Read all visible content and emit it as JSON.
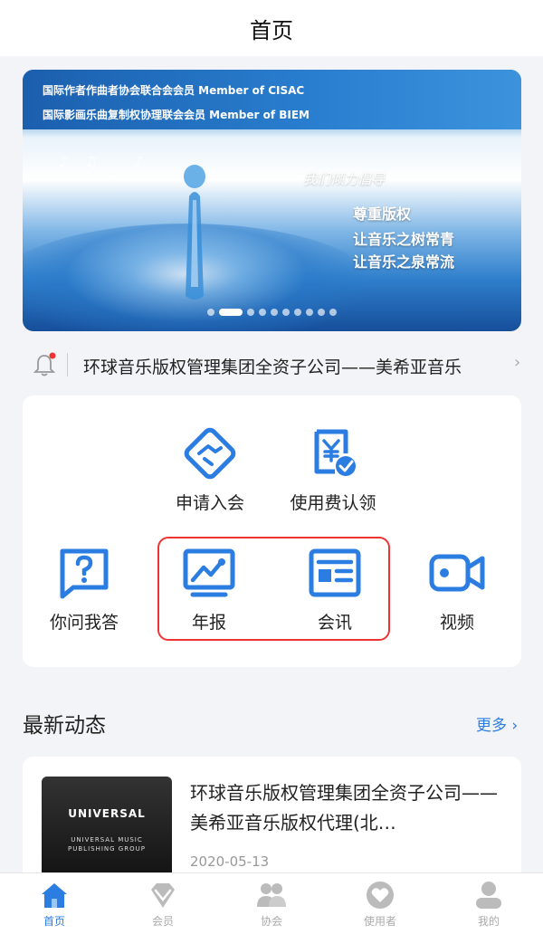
{
  "header": {
    "title": "首页"
  },
  "banner": {
    "line1": "国际作者作曲者协会联合会会员 Member of CISAC",
    "line2": "国际影画乐曲复制权协理联会会员 Member of BIEM",
    "slogan": "我们倾力倡导",
    "slogan_line1": "尊重版权",
    "slogan_line2": "让音乐之树常青",
    "slogan_line3": "让音乐之泉常流",
    "slide_count": 10,
    "active_slide": 1
  },
  "notice": {
    "icon": "bell-icon",
    "text": "环球音乐版权管理集团全资子公司——美希亚音乐"
  },
  "services": {
    "row1": [
      {
        "label": "申请入会",
        "icon": "handshake-icon"
      },
      {
        "label": "使用费认领",
        "icon": "yen-bill-icon"
      }
    ],
    "row2": [
      {
        "label": "你问我答",
        "icon": "question-chat-icon"
      },
      {
        "label": "年报",
        "icon": "picture-icon"
      },
      {
        "label": "会讯",
        "icon": "newsletter-icon"
      },
      {
        "label": "视频",
        "icon": "video-camera-icon"
      }
    ],
    "accent": "#2b7de1",
    "highlight_color": "#e33333"
  },
  "latest": {
    "title": "最新动态",
    "more": "更多 ›",
    "items": [
      {
        "thumb_brand": "UNIVERSAL",
        "thumb_sub1": "UNIVERSAL MUSIC",
        "thumb_sub2": "PUBLISHING GROUP",
        "headline": "环球音乐版权管理集团全资子公司——美希亚音乐版权代理(北…",
        "date": "2020-05-13"
      }
    ]
  },
  "tabbar": {
    "tabs": [
      {
        "label": "首页",
        "icon": "home-icon",
        "active": true
      },
      {
        "label": "会员",
        "icon": "gem-icon",
        "active": false
      },
      {
        "label": "协会",
        "icon": "users-icon",
        "active": false
      },
      {
        "label": "使用者",
        "icon": "heart-badge-icon",
        "active": false
      },
      {
        "label": "我的",
        "icon": "person-icon",
        "active": false
      }
    ]
  }
}
